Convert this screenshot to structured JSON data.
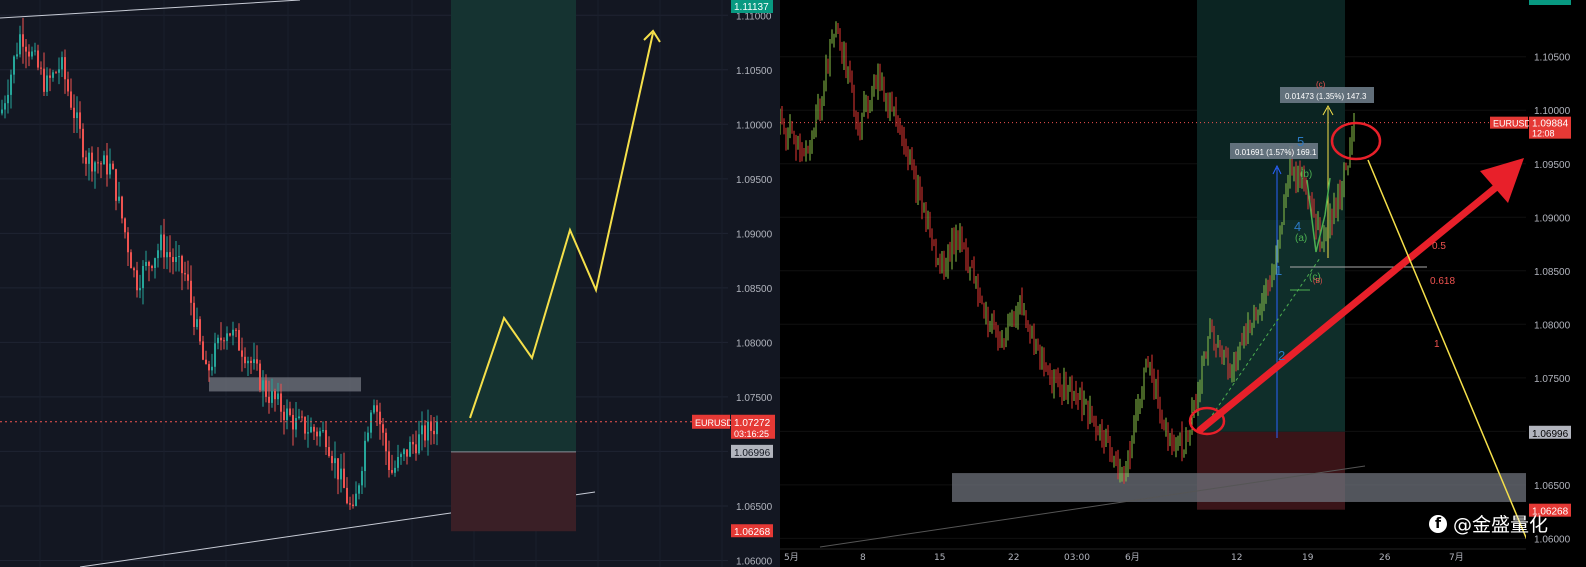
{
  "chart_data": [
    {
      "type": "candlestick",
      "symbol": "EURUSD",
      "y_ticks": [
        "1.11000",
        "1.10500",
        "1.10000",
        "1.09500",
        "1.09000",
        "1.08500",
        "1.08000",
        "1.07500",
        "1.07000",
        "1.06500",
        "1.06000"
      ],
      "ylim": [
        1.0594,
        1.1114
      ],
      "price_labels": {
        "top": "1.11137",
        "current": "1.07272",
        "countdown": "03:16:25",
        "stop": "1.06996",
        "low": "1.06268"
      },
      "symbol_label": "EURUSD",
      "candles_summary": {
        "open": 1.104,
        "high": 1.109,
        "low": 1.0635,
        "close": 1.0727,
        "count": 150
      }
    },
    {
      "type": "candlestick",
      "symbol": "EURUSD",
      "y_ticks": [
        "1.10500",
        "1.10000",
        "1.09500",
        "1.09000",
        "1.08500",
        "1.08000",
        "1.07500",
        "1.07000",
        "1.06500",
        "1.06000"
      ],
      "ylim": [
        1.0591,
        1.1103
      ],
      "x_ticks": [
        "5月",
        "8",
        "15",
        "22",
        "03:00",
        "6月",
        "12",
        "19",
        "26",
        "7月"
      ],
      "price_labels": {
        "current": "1.09884",
        "countdown": "12:08",
        "stop": "1.06996",
        "low": "1.06268"
      },
      "symbol_label": "EURUSD",
      "measure_1": "0.01691 (1.57%) 169.1",
      "measure_2": "0.01473 (1.35%) 147.3",
      "wave_labels": {
        "w1": "1",
        "w2": "2",
        "w4": "4",
        "w5": "5",
        "a": "(a)",
        "b": "(b)",
        "c": "(c)",
        "cTop": "(c)",
        "bSmall": "(B)"
      },
      "fib_labels": {
        "f05": "0.5",
        "f0618": "0.618",
        "f1": "1"
      }
    }
  ],
  "watermark": {
    "icon": "facebook-icon",
    "text": "@金盛量化"
  },
  "colors": {
    "up": "#26a69a",
    "down": "#ef5350",
    "arrow": "#e8202a",
    "path": "#f5e04a",
    "target_zone": "#1a3d38",
    "stop_zone": "#3d1a1f"
  }
}
